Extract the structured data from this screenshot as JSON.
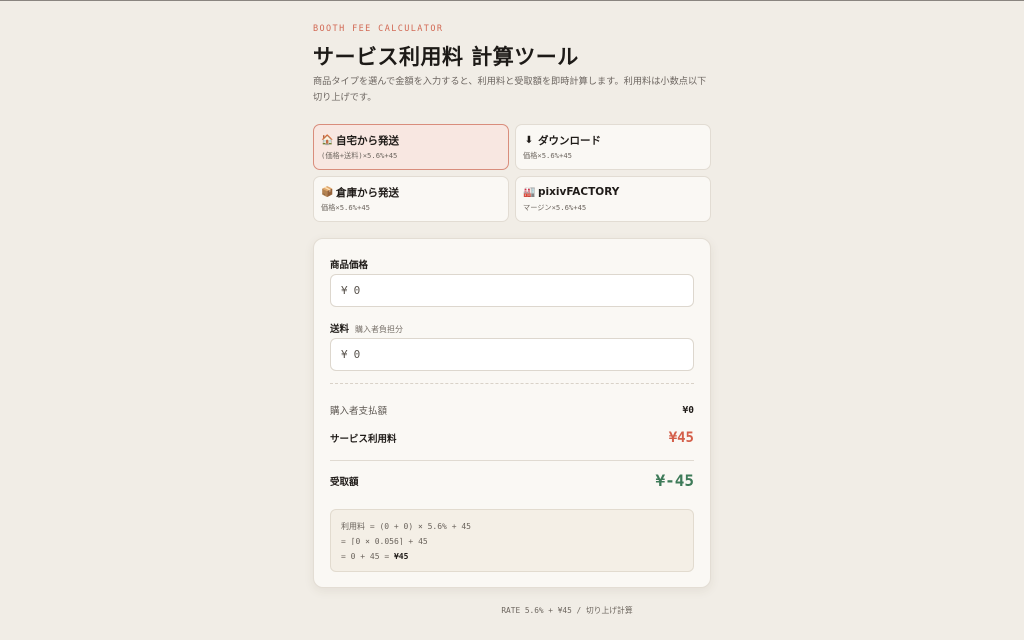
{
  "header": {
    "eyebrow": "BOOTH FEE CALCULATOR",
    "title": "サービス利用料 計算ツール",
    "description": "商品タイプを選んで金額を入力すると、利用料と受取額を即時計算します。利用料は小数点以下切り上げです。"
  },
  "types": [
    {
      "icon": "house-icon",
      "glyph": "🏠",
      "name": "自宅から発送",
      "formula": "(価格+送料)×5.6%+45",
      "active": true
    },
    {
      "icon": "download-icon",
      "glyph": "⬇",
      "name": "ダウンロード",
      "formula": "価格×5.6%+45",
      "active": false
    },
    {
      "icon": "package-icon",
      "glyph": "📦",
      "name": "倉庫から発送",
      "formula": "価格×5.6%+45",
      "active": false
    },
    {
      "icon": "factory-icon",
      "glyph": "🏭",
      "name": "pixivFACTORY",
      "formula": "マージン×5.6%+45",
      "active": false
    }
  ],
  "form": {
    "price_label": "商品価格",
    "price_currency": "¥",
    "price_value": "0",
    "shipping_label": "送料",
    "shipping_note": "購入者負担分",
    "shipping_currency": "¥",
    "shipping_value": "0"
  },
  "results": {
    "buyer_total_label": "購入者支払額",
    "buyer_total_value": "¥0",
    "fee_label": "サービス利用料",
    "fee_value": "¥45",
    "receive_label": "受取額",
    "receive_value": "¥-45"
  },
  "breakdown": {
    "line1": "利用料 = (0 + 0) × 5.6% + 45",
    "line2": "= ⌈0 × 0.056⌉ + 45",
    "line3_prefix": "= 0 + 45 = ",
    "line3_result": "¥45"
  },
  "footer": "RATE 5.6% + ¥45 / 切り上げ計算",
  "colors": {
    "accent": "#d26a55",
    "fee": "#d45f4a",
    "receive": "#3d7a58",
    "background": "#f1ede6"
  }
}
